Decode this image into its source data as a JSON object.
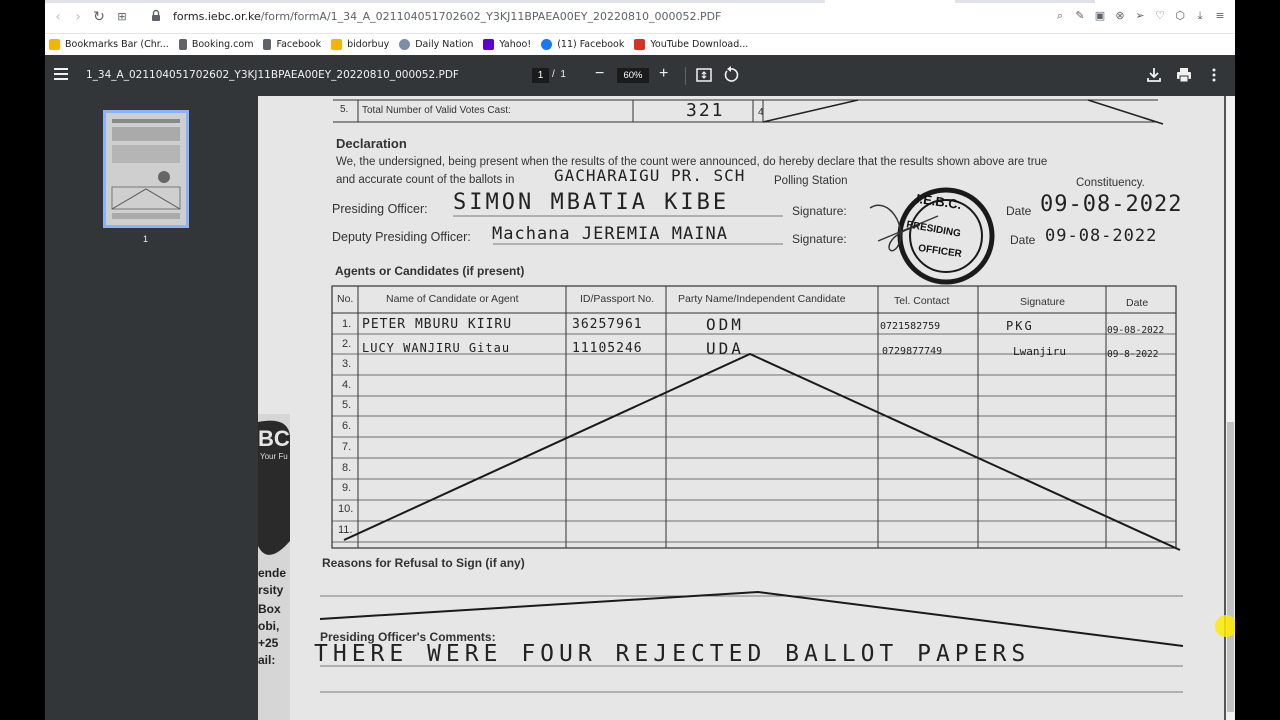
{
  "browser": {
    "url_host": "forms.iebc.or.ke",
    "url_path": "/form/formA/1_34_A_021104051702602_Y3KJ11BPAEA00EY_20220810_000052.PDF",
    "bookmarks": [
      "Bookmarks Bar (Chr...",
      "Booking.com",
      "Facebook",
      "bidorbuy",
      "Daily Nation",
      "Yahoo!",
      "(11) Facebook",
      "YouTube Download..."
    ]
  },
  "pdf": {
    "title": "1_34_A_021104051702602_Y3KJ11BPAEA00EY_20220810_000052.PDF",
    "current_page": "1",
    "page_sep": "/",
    "total_pages": "1",
    "zoom": "60%",
    "thumb_label": "1"
  },
  "document": {
    "row5_label": "5.",
    "row5_text": "Total Number of Valid Votes Cast:",
    "row5_value": "321",
    "row4_label": "4",
    "declaration_heading": "Declaration",
    "declaration_line1": "We, the undersigned, being present when the results of the count were announced, do hereby declare that the results shown above are true",
    "declaration_line2_a": "and accurate count of the ballots in",
    "polling_station_hw": "GACHARAIGU PR. SCH",
    "declaration_line2_b": "Polling Station",
    "constituency_label": "Constituency.",
    "presiding_label": "Presiding Officer:",
    "presiding_name": "SIMON MBATIA KIBE",
    "signature_label": "Signature:",
    "date_label": "Date",
    "presiding_date": "09-08-2022",
    "deputy_label": "Deputy Presiding Officer:",
    "deputy_name": "Machana JEREMIA MAINA",
    "deputy_date": "09-08-2022",
    "stamp_top": "I.E.B.C.",
    "stamp_mid": "PRESIDING",
    "stamp_bot": "OFFICER",
    "agents_heading": "Agents or Candidates (if present)",
    "table_headers": [
      "No.",
      "Name of Candidate or Agent",
      "ID/Passport No.",
      "Party Name/Independent Candidate",
      "Tel. Contact",
      "Signature",
      "Date"
    ],
    "table_rows": [
      {
        "no": "1.",
        "name": "PETER MBURU KIIRU",
        "id": "36257961",
        "party": "ODM",
        "tel": "0721582759",
        "sig": "PKG",
        "date": "09-08-2022"
      },
      {
        "no": "2.",
        "name": "LUCY WANJIRU Gitau",
        "id": "11105246",
        "party": "UDA",
        "tel": "0729877749",
        "sig": "Lwanjiru",
        "date": "09-8-2022"
      },
      {
        "no": "3.",
        "name": "",
        "id": "",
        "party": "",
        "tel": "",
        "sig": "",
        "date": ""
      },
      {
        "no": "4.",
        "name": "",
        "id": "",
        "party": "",
        "tel": "",
        "sig": "",
        "date": ""
      },
      {
        "no": "5.",
        "name": "",
        "id": "",
        "party": "",
        "tel": "",
        "sig": "",
        "date": ""
      },
      {
        "no": "6.",
        "name": "",
        "id": "",
        "party": "",
        "tel": "",
        "sig": "",
        "date": ""
      },
      {
        "no": "7.",
        "name": "",
        "id": "",
        "party": "",
        "tel": "",
        "sig": "",
        "date": ""
      },
      {
        "no": "8.",
        "name": "",
        "id": "",
        "party": "",
        "tel": "",
        "sig": "",
        "date": ""
      },
      {
        "no": "9.",
        "name": "",
        "id": "",
        "party": "",
        "tel": "",
        "sig": "",
        "date": ""
      },
      {
        "no": "10.",
        "name": "",
        "id": "",
        "party": "",
        "tel": "",
        "sig": "",
        "date": ""
      },
      {
        "no": "11.",
        "name": "",
        "id": "",
        "party": "",
        "tel": "",
        "sig": "",
        "date": ""
      }
    ],
    "refusal_heading": "Reasons for Refusal to Sign (if any)",
    "comments_heading": "Presiding Officer's Comments:",
    "comments_text": "THERE WERE FOUR REJECTED BALLOT PAPERS",
    "left_fragment": [
      "BC",
      "Your Fu",
      "ende",
      "rsity",
      "Box",
      "obi,",
      "+25",
      "ail:"
    ]
  },
  "colors": {
    "pdf_toolbar": "#323639",
    "viewer_bg": "#525659",
    "thumb_border": "#8ab4f8",
    "paper": "#e4e4e4"
  }
}
